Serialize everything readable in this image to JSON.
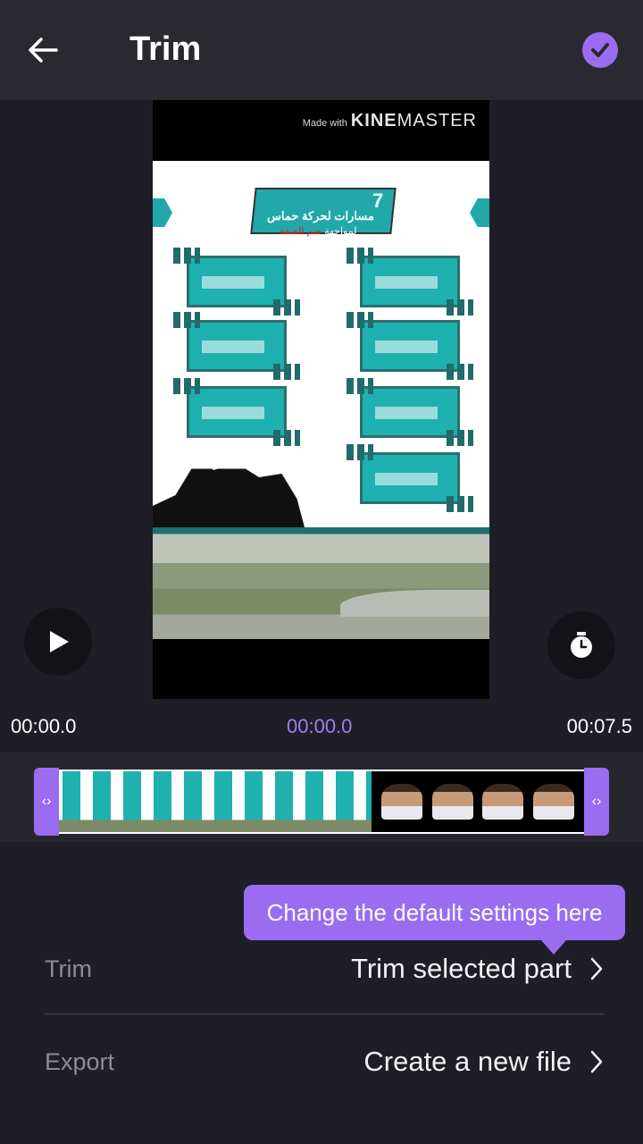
{
  "header": {
    "title": "Trim",
    "back_icon": "arrow-left-icon",
    "confirm_icon": "check-circle-icon"
  },
  "preview": {
    "watermark_prefix": "Made with",
    "watermark_brand_bold": "KINE",
    "watermark_brand_light": "MASTER",
    "video_title_number": "7",
    "video_title_line1": "مسارات لحركة حماس",
    "video_title_line2_a": "لمواجهة",
    "video_title_line2_b": "ضم الضفة"
  },
  "controls": {
    "play_icon": "play-icon",
    "timer_icon": "stopwatch-icon"
  },
  "times": {
    "start": "00:00.0",
    "current": "00:00.0",
    "end": "00:07.5"
  },
  "timeline": {
    "left_handle": "‹›",
    "right_handle": "‹›"
  },
  "tooltip": {
    "text": "Change the default settings here"
  },
  "settings": {
    "trim_label": "Trim",
    "trim_value": "Trim selected part",
    "export_label": "Export",
    "export_value": "Create a new file"
  },
  "colors": {
    "accent": "#9a6cf2",
    "background": "#1f1e26",
    "header": "#2a2930"
  }
}
